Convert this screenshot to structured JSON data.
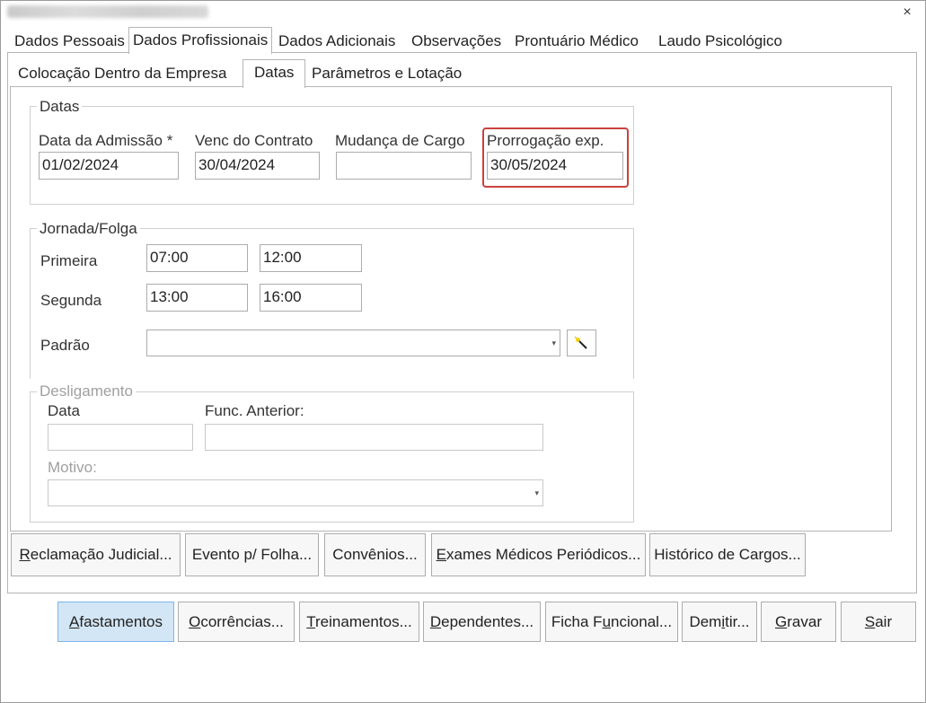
{
  "window": {
    "close_glyph": "×"
  },
  "tabs_main": [
    {
      "label": "Dados Pessoais"
    },
    {
      "label": "Dados Profissionais"
    },
    {
      "label": "Dados Adicionais"
    },
    {
      "label": "Observações"
    },
    {
      "label": "Prontuário Médico"
    },
    {
      "label": "Laudo Psicológico"
    }
  ],
  "tabs_sub": [
    {
      "label": "Colocação Dentro da Empresa"
    },
    {
      "label": "Datas"
    },
    {
      "label": "Parâmetros e Lotação"
    }
  ],
  "datas": {
    "legend": "Datas",
    "admissao": {
      "label": "Data da Admissão *",
      "value": "01/02/2024"
    },
    "venc_contrato": {
      "label": "Venc do Contrato",
      "value": "30/04/2024"
    },
    "mudanca_cargo": {
      "label": "Mudança de Cargo",
      "value": ""
    },
    "prorrogacao": {
      "label": "Prorrogação exp.",
      "value": "30/05/2024"
    }
  },
  "jornada": {
    "legend": "Jornada/Folga",
    "primeira": {
      "label": "Primeira",
      "inicio": "07:00",
      "fim": "12:00"
    },
    "segunda": {
      "label": "Segunda",
      "inicio": "13:00",
      "fim": "16:00"
    },
    "padrao": {
      "label": "Padrão",
      "value": "",
      "arrow": "▾",
      "wand_icon": "magic-wand-icon"
    }
  },
  "desligamento": {
    "legend": "Desligamento",
    "data_label": "Data",
    "data_value": "",
    "func_anterior_label": "Func. Anterior:",
    "func_anterior_value": "",
    "motivo_label": "Motivo:",
    "motivo_value": "",
    "arrow": "▾"
  },
  "buttons_row1": [
    {
      "ul": "R",
      "rest": "eclamação Judicial..."
    },
    {
      "ul": "",
      "rest": "Evento p/ Folha..."
    },
    {
      "ul": "",
      "rest": "Convênios..."
    },
    {
      "ul": "E",
      "rest": "xames Médicos Periódicos..."
    },
    {
      "ul": "",
      "rest": "Histórico de Cargos..."
    }
  ],
  "buttons_row2": [
    {
      "pre": "",
      "ul": "A",
      "rest": "fastamentos"
    },
    {
      "pre": "",
      "ul": "O",
      "rest": "corrências..."
    },
    {
      "pre": "",
      "ul": "T",
      "rest": "reinamentos..."
    },
    {
      "pre": "",
      "ul": "D",
      "rest": "ependentes..."
    },
    {
      "pre": "Ficha F",
      "ul": "u",
      "rest": "ncional..."
    },
    {
      "pre": "Dem",
      "ul": "i",
      "rest": "tir..."
    },
    {
      "pre": "",
      "ul": "G",
      "rest": "ravar"
    },
    {
      "pre": "",
      "ul": "S",
      "rest": "air"
    }
  ],
  "colors": {
    "accent_button": "#d3e6f5",
    "highlight_border": "#c8423f"
  }
}
